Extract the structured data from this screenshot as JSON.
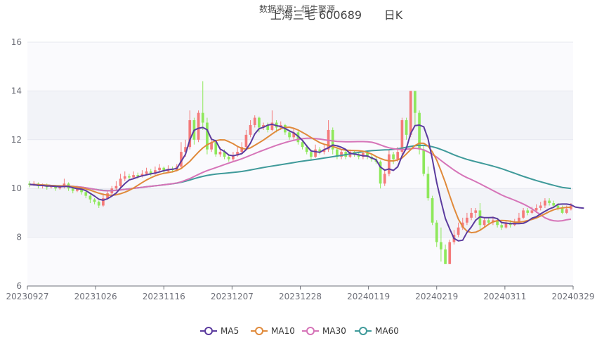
{
  "source_text": "数据来源：恒生聚源",
  "title_main": "上海三毛 600689",
  "title_period": "日K",
  "chart_data": {
    "type": "candlestick",
    "ylim": [
      6,
      16
    ],
    "yticks": [
      6,
      8,
      10,
      12,
      14,
      16
    ],
    "xticks": [
      "20230927",
      "20231026",
      "20231116",
      "20231207",
      "20231228",
      "20240119",
      "20240219",
      "20240311",
      "20240329"
    ],
    "colors": {
      "up": "#f47a7a",
      "down": "#8ee85b",
      "ma5": "#5b3b9e",
      "ma10": "#e08a3b",
      "ma30": "#d674b8",
      "ma60": "#3f9a9a"
    },
    "legend": [
      {
        "name": "MA5",
        "color": "#5b3b9e"
      },
      {
        "name": "MA10",
        "color": "#e08a3b"
      },
      {
        "name": "MA30",
        "color": "#d674b8"
      },
      {
        "name": "MA60",
        "color": "#3f9a9a"
      }
    ],
    "candles": [
      [
        10.2,
        10.15,
        10.3,
        10.05
      ],
      [
        10.15,
        10.2,
        10.3,
        10.1
      ],
      [
        10.2,
        10.1,
        10.25,
        10.0
      ],
      [
        10.1,
        10.15,
        10.2,
        10.0
      ],
      [
        10.15,
        10.05,
        10.2,
        9.95
      ],
      [
        10.05,
        10.1,
        10.15,
        10.0
      ],
      [
        10.1,
        10.0,
        10.15,
        9.9
      ],
      [
        10.0,
        10.05,
        10.1,
        9.95
      ],
      [
        10.05,
        10.2,
        10.4,
        10.0
      ],
      [
        10.2,
        10.0,
        10.25,
        9.9
      ],
      [
        10.0,
        9.9,
        10.05,
        9.8
      ],
      [
        9.9,
        10.0,
        10.1,
        9.85
      ],
      [
        10.0,
        9.85,
        10.05,
        9.75
      ],
      [
        9.85,
        9.7,
        9.9,
        9.6
      ],
      [
        9.7,
        9.55,
        9.75,
        9.4
      ],
      [
        9.55,
        9.45,
        9.6,
        9.35
      ],
      [
        9.45,
        9.3,
        9.5,
        9.2
      ],
      [
        9.3,
        9.6,
        9.8,
        9.25
      ],
      [
        9.6,
        9.8,
        9.9,
        9.55
      ],
      [
        9.8,
        10.0,
        10.1,
        9.75
      ],
      [
        10.0,
        10.1,
        10.3,
        9.95
      ],
      [
        10.1,
        10.4,
        10.6,
        10.05
      ],
      [
        10.4,
        10.5,
        10.7,
        10.3
      ],
      [
        10.5,
        10.45,
        10.6,
        10.35
      ],
      [
        10.45,
        10.55,
        10.7,
        10.4
      ],
      [
        10.55,
        10.5,
        10.65,
        10.4
      ],
      [
        10.5,
        10.6,
        10.75,
        10.45
      ],
      [
        10.6,
        10.7,
        10.85,
        10.55
      ],
      [
        10.7,
        10.6,
        10.8,
        10.5
      ],
      [
        10.6,
        10.75,
        10.9,
        10.55
      ],
      [
        10.75,
        10.85,
        11.0,
        10.7
      ],
      [
        10.85,
        10.7,
        10.9,
        10.6
      ],
      [
        10.7,
        10.8,
        10.95,
        10.65
      ],
      [
        10.8,
        10.75,
        10.9,
        10.65
      ],
      [
        10.75,
        10.9,
        11.0,
        10.7
      ],
      [
        10.9,
        11.5,
        11.9,
        10.85
      ],
      [
        11.5,
        11.7,
        12.0,
        11.3
      ],
      [
        11.7,
        12.8,
        13.2,
        11.6
      ],
      [
        12.8,
        12.0,
        12.9,
        11.8
      ],
      [
        12.0,
        13.1,
        13.2,
        11.9
      ],
      [
        13.1,
        12.7,
        14.4,
        12.4
      ],
      [
        12.7,
        11.6,
        12.9,
        11.4
      ],
      [
        11.6,
        11.9,
        12.1,
        11.5
      ],
      [
        11.9,
        11.4,
        12.0,
        11.3
      ],
      [
        11.4,
        11.5,
        11.7,
        11.3
      ],
      [
        11.5,
        11.3,
        11.6,
        11.2
      ],
      [
        11.3,
        11.2,
        11.4,
        11.1
      ],
      [
        11.2,
        11.35,
        11.5,
        11.1
      ],
      [
        11.35,
        11.5,
        11.7,
        11.3
      ],
      [
        11.5,
        11.7,
        11.9,
        11.4
      ],
      [
        11.7,
        12.2,
        12.4,
        11.6
      ],
      [
        12.2,
        12.6,
        12.8,
        12.1
      ],
      [
        12.6,
        12.9,
        13.0,
        12.5
      ],
      [
        12.9,
        12.5,
        12.95,
        12.3
      ],
      [
        12.5,
        12.6,
        12.7,
        12.4
      ],
      [
        12.6,
        12.4,
        12.7,
        12.3
      ],
      [
        12.4,
        12.7,
        13.2,
        12.35
      ],
      [
        12.7,
        12.5,
        12.8,
        12.3
      ],
      [
        12.5,
        12.6,
        12.75,
        12.4
      ],
      [
        12.6,
        12.3,
        12.65,
        12.2
      ],
      [
        12.3,
        12.1,
        12.4,
        12.0
      ],
      [
        12.1,
        12.3,
        12.5,
        12.0
      ],
      [
        12.3,
        11.9,
        12.35,
        11.8
      ],
      [
        11.9,
        11.7,
        12.0,
        11.6
      ],
      [
        11.7,
        11.5,
        11.8,
        11.4
      ],
      [
        11.5,
        11.3,
        11.6,
        11.2
      ],
      [
        11.3,
        11.6,
        11.8,
        11.25
      ],
      [
        11.6,
        11.5,
        11.7,
        11.4
      ],
      [
        11.5,
        11.6,
        11.8,
        11.4
      ],
      [
        11.6,
        12.4,
        12.8,
        11.5
      ],
      [
        12.4,
        11.6,
        12.5,
        11.4
      ],
      [
        11.6,
        11.3,
        11.7,
        11.2
      ],
      [
        11.3,
        11.5,
        11.6,
        11.2
      ],
      [
        11.5,
        11.3,
        11.6,
        11.2
      ],
      [
        11.3,
        11.5,
        11.6,
        11.25
      ],
      [
        11.5,
        11.4,
        11.55,
        11.3
      ],
      [
        11.4,
        11.3,
        11.5,
        11.2
      ],
      [
        11.3,
        11.45,
        11.55,
        11.2
      ],
      [
        11.45,
        11.3,
        11.5,
        11.2
      ],
      [
        11.3,
        11.2,
        11.4,
        11.1
      ],
      [
        11.2,
        11.1,
        11.3,
        11.0
      ],
      [
        11.1,
        10.2,
        11.15,
        10.0
      ],
      [
        10.2,
        10.6,
        10.8,
        10.1
      ],
      [
        10.6,
        11.4,
        11.6,
        10.5
      ],
      [
        11.4,
        11.2,
        11.5,
        11.0
      ],
      [
        11.2,
        11.5,
        11.7,
        11.1
      ],
      [
        11.5,
        12.8,
        12.9,
        11.4
      ],
      [
        12.8,
        12.2,
        12.9,
        12.0
      ],
      [
        12.2,
        14.0,
        14.0,
        12.1
      ],
      [
        14.0,
        13.1,
        14.0,
        12.6
      ],
      [
        13.1,
        11.6,
        13.2,
        11.4
      ],
      [
        11.6,
        10.6,
        11.8,
        10.5
      ],
      [
        10.6,
        9.6,
        10.9,
        9.5
      ],
      [
        9.6,
        8.6,
        9.7,
        8.5
      ],
      [
        8.6,
        7.8,
        8.7,
        7.6
      ],
      [
        7.8,
        7.5,
        8.4,
        7.0
      ],
      [
        7.5,
        6.9,
        7.7,
        6.9
      ],
      [
        6.9,
        7.8,
        7.9,
        6.9
      ],
      [
        7.8,
        8.1,
        8.3,
        7.7
      ],
      [
        8.1,
        8.4,
        8.6,
        8.0
      ],
      [
        8.4,
        8.6,
        8.8,
        8.3
      ],
      [
        8.6,
        8.8,
        9.0,
        8.5
      ],
      [
        8.8,
        9.0,
        9.2,
        8.7
      ],
      [
        9.0,
        9.1,
        9.2,
        8.8
      ],
      [
        9.1,
        8.5,
        9.4,
        8.3
      ],
      [
        8.5,
        8.7,
        8.8,
        8.4
      ],
      [
        8.7,
        8.6,
        8.8,
        8.5
      ],
      [
        8.6,
        8.7,
        8.85,
        8.5
      ],
      [
        8.7,
        8.5,
        8.8,
        8.4
      ],
      [
        8.5,
        8.4,
        8.6,
        8.3
      ],
      [
        8.4,
        8.6,
        8.7,
        8.35
      ],
      [
        8.6,
        8.5,
        8.7,
        8.4
      ],
      [
        8.5,
        8.6,
        8.75,
        8.45
      ],
      [
        8.6,
        8.8,
        9.0,
        8.55
      ],
      [
        8.8,
        9.1,
        9.2,
        8.75
      ],
      [
        9.1,
        9.0,
        9.2,
        8.9
      ],
      [
        9.0,
        9.1,
        9.25,
        8.95
      ],
      [
        9.1,
        9.2,
        9.35,
        9.0
      ],
      [
        9.2,
        9.3,
        9.45,
        9.1
      ],
      [
        9.3,
        9.5,
        9.6,
        9.2
      ],
      [
        9.5,
        9.4,
        9.6,
        9.3
      ],
      [
        9.4,
        9.3,
        9.5,
        9.2
      ],
      [
        9.3,
        9.2,
        9.4,
        9.1
      ],
      [
        9.2,
        9.0,
        9.3,
        8.95
      ],
      [
        9.0,
        9.15,
        9.3,
        8.95
      ],
      [
        9.15,
        9.3,
        9.4,
        9.1
      ]
    ],
    "ma5": [
      10.17,
      10.15,
      10.13,
      10.12,
      10.1,
      10.1,
      10.08,
      10.07,
      10.08,
      10.08,
      10.03,
      9.99,
      9.97,
      9.91,
      9.8,
      9.69,
      9.56,
      9.52,
      9.58,
      9.69,
      9.81,
      10.02,
      10.2,
      10.35,
      10.4,
      10.47,
      10.52,
      10.56,
      10.6,
      10.63,
      10.68,
      10.73,
      10.77,
      10.79,
      10.82,
      11.11,
      11.4,
      12.0,
      12.39,
      12.47,
      12.5,
      12.41,
      12.02,
      11.95,
      11.62,
      11.52,
      11.37,
      11.34,
      11.38,
      11.43,
      11.59,
      11.86,
      12.24,
      12.45,
      12.51,
      12.6,
      12.63,
      12.58,
      12.54,
      12.46,
      12.36,
      12.28,
      12.14,
      11.97,
      11.74,
      11.54,
      11.51,
      11.48,
      11.59,
      11.67,
      11.78,
      11.75,
      11.69,
      11.6,
      11.44,
      11.41,
      11.38,
      11.34,
      11.33,
      11.25,
      11.18,
      10.88,
      10.75,
      10.8,
      10.74,
      10.89,
      11.34,
      11.65,
      12.26,
      12.58,
      12.6,
      12.53,
      12.04,
      11.2,
      10.24,
      9.48,
      8.77,
      8.34,
      7.95,
      7.85,
      7.88,
      8.2,
      8.42,
      8.7,
      8.84,
      8.8,
      8.8,
      8.81,
      8.76,
      8.6,
      8.58,
      8.56,
      8.56,
      8.56,
      8.57,
      8.65,
      8.78,
      8.84,
      8.96,
      9.06,
      9.16,
      9.23,
      9.35,
      9.36,
      9.36,
      9.33,
      9.24,
      9.21,
      9.19
    ]
  }
}
